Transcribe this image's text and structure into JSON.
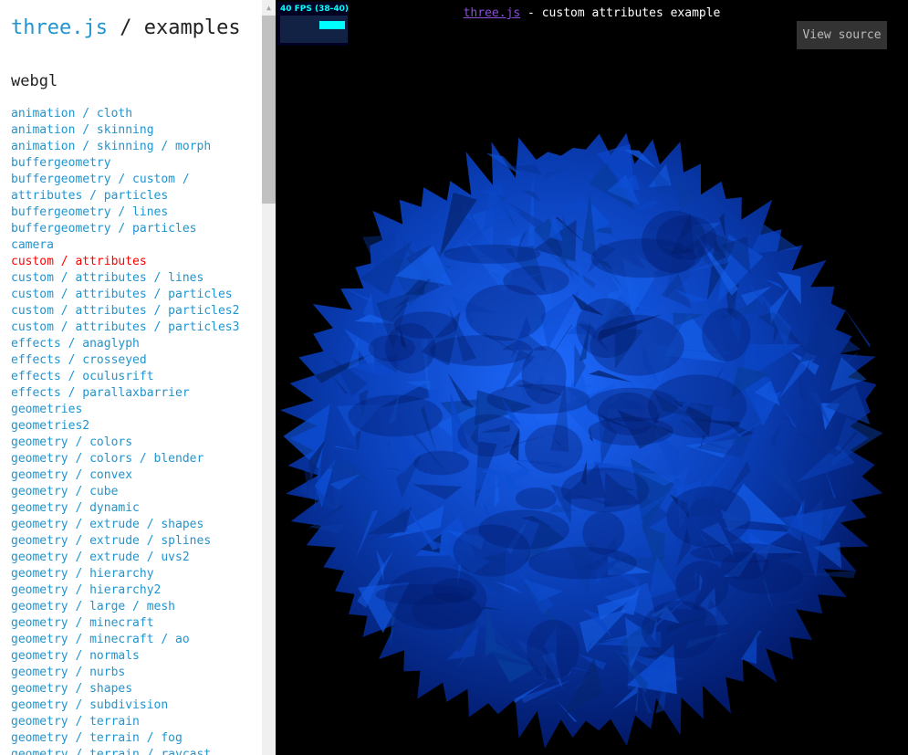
{
  "panel": {
    "title_brand": "three.js",
    "title_rest": " / examples",
    "section": "webgl",
    "selected_index": 9,
    "items": [
      "animation / cloth",
      "animation / skinning",
      "animation / skinning / morph",
      "buffergeometry",
      "buffergeometry / custom /",
      "attributes / particles",
      "buffergeometry / lines",
      "buffergeometry / particles",
      "camera",
      "custom / attributes",
      "custom / attributes / lines",
      "custom / attributes / particles",
      "custom / attributes / particles2",
      "custom / attributes / particles3",
      "effects / anaglyph",
      "effects / crosseyed",
      "effects / oculusrift",
      "effects / parallaxbarrier",
      "geometries",
      "geometries2",
      "geometry / colors",
      "geometry / colors / blender",
      "geometry / convex",
      "geometry / cube",
      "geometry / dynamic",
      "geometry / extrude / shapes",
      "geometry / extrude / splines",
      "geometry / extrude / uvs2",
      "geometry / hierarchy",
      "geometry / hierarchy2",
      "geometry / large / mesh",
      "geometry / minecraft",
      "geometry / minecraft / ao",
      "geometry / normals",
      "geometry / nurbs",
      "geometry / shapes",
      "geometry / subdivision",
      "geometry / terrain",
      "geometry / terrain / fog",
      "geometry / terrain / raycast"
    ]
  },
  "viewer": {
    "info_link": "three.js",
    "info_text": " - custom attributes example",
    "stats_text": "40 FPS (38-40)",
    "view_source_label": "View source"
  },
  "colors": {
    "link": "#2194ce",
    "selected": "#ff0000",
    "background": "#000000",
    "mesh_base": "#0a3fb8",
    "mesh_light": "#1e6aff",
    "mesh_dark": "#021a6a"
  },
  "icons": {
    "scroll_up": "triangle-up-icon"
  }
}
